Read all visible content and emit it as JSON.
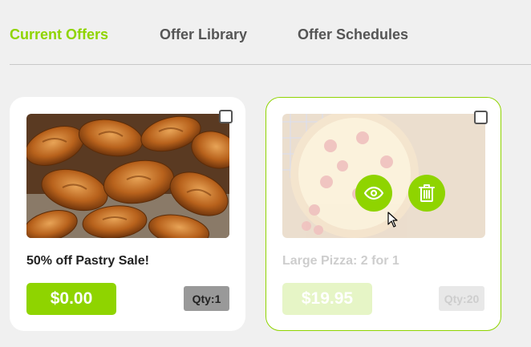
{
  "tabs": [
    {
      "label": "Current Offers",
      "active": true
    },
    {
      "label": "Offer Library",
      "active": false
    },
    {
      "label": "Offer Schedules",
      "active": false
    }
  ],
  "offers": [
    {
      "title": "50% off Pastry Sale!",
      "price": "$0.00",
      "qty": "Qty:1",
      "image": "croissants-photo",
      "checked": false
    },
    {
      "title": "Large Pizza: 2 for 1",
      "price": "$19.95",
      "qty": "Qty:20",
      "image": "pizza-photo",
      "checked": false,
      "hover_actions": [
        "eye-icon",
        "trash-icon"
      ]
    }
  ],
  "colors": {
    "accent": "#8fd400",
    "background": "#f0f0f0",
    "tab_inactive": "#555555"
  }
}
